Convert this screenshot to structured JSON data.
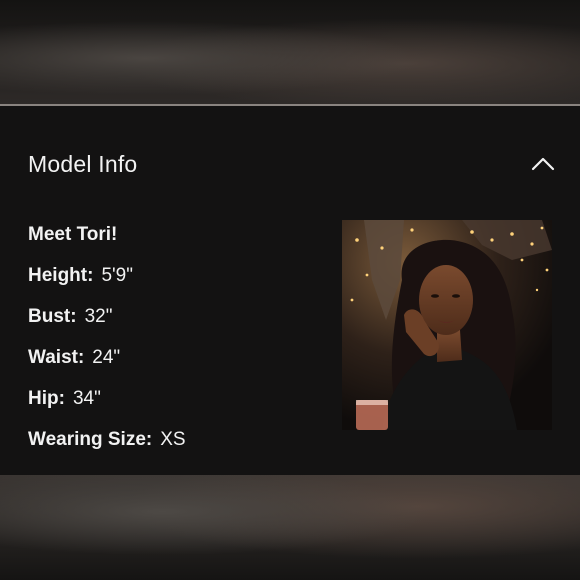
{
  "panel": {
    "title": "Model Info",
    "toggle_icon": "chevron-up-icon"
  },
  "model": {
    "intro": "Meet Tori!",
    "details": [
      {
        "label": "Height:",
        "value": "5'9\""
      },
      {
        "label": "Bust:",
        "value": "32\""
      },
      {
        "label": "Waist:",
        "value": "24\""
      },
      {
        "label": "Hip:",
        "value": "34\""
      },
      {
        "label": "Wearing Size:",
        "value": "XS"
      }
    ]
  },
  "colors": {
    "panel_background": "#131212",
    "text": "#f2f2f2"
  }
}
